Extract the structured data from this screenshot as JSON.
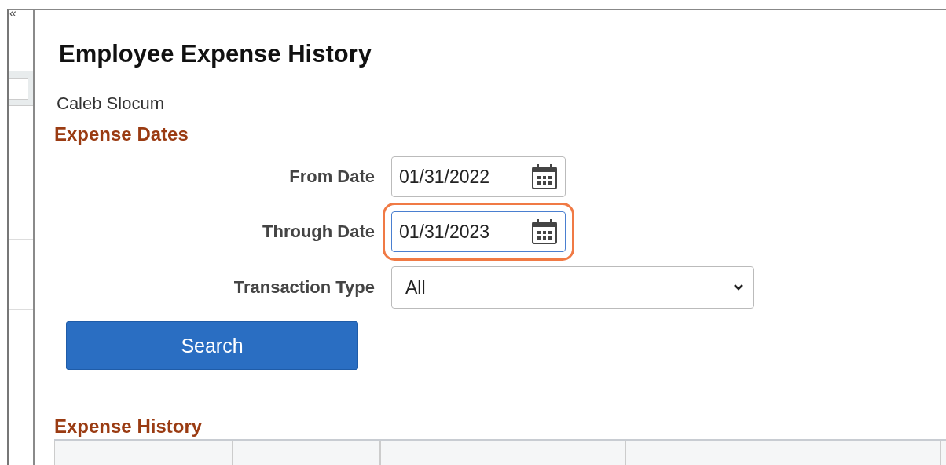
{
  "sidebar": {
    "collapse_icon": "«"
  },
  "page": {
    "title": "Employee Expense History",
    "employee": "Caleb Slocum"
  },
  "expense_dates": {
    "heading": "Expense Dates",
    "fields": [
      {
        "label": "From Date",
        "kind": "date",
        "value": "01/31/2022",
        "highlighted": false
      },
      {
        "label": "Through Date",
        "kind": "date",
        "value": "01/31/2023",
        "highlighted": true
      },
      {
        "label": "Transaction Type",
        "kind": "select",
        "value": "All",
        "highlighted": false
      }
    ]
  },
  "search_button": "Search",
  "expense_history": {
    "heading": "Expense History"
  }
}
